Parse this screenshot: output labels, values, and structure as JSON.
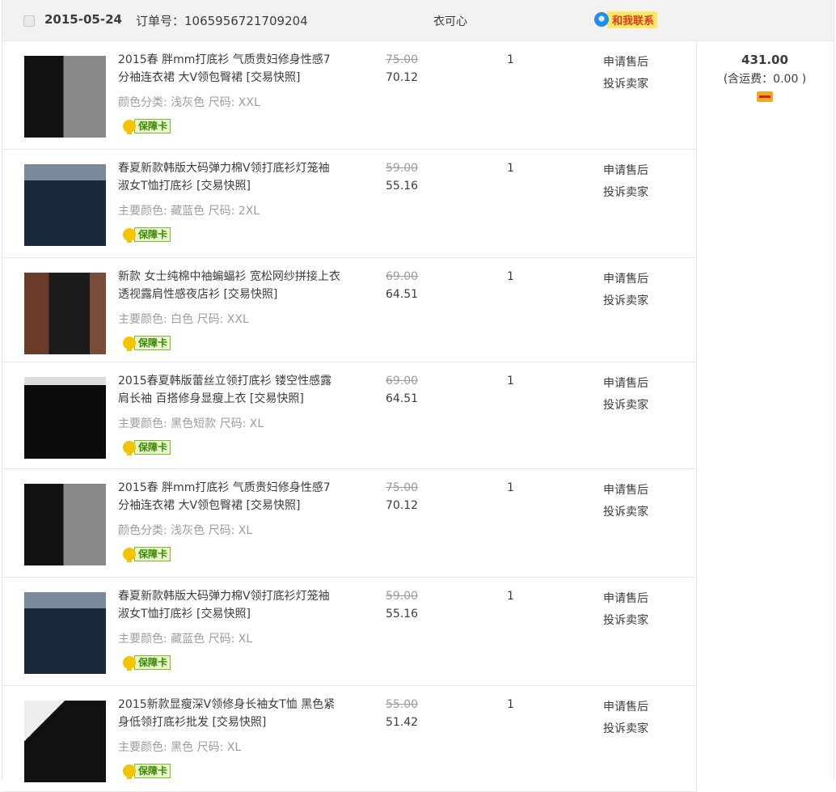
{
  "order": {
    "date": "2015-05-24",
    "order_label": "订单号：1065956721709204",
    "shop": "衣可心",
    "chat_label": "和我联系",
    "total": "431.00",
    "shipping": "(含运费：0.00 )"
  },
  "items": [
    {
      "title": "2015春 胖mm打底衫 气质贵妇修身性感7分袖连衣裙 大V领包臀裙 [交易快照]",
      "sku": "颜色分类: 浅灰色 尺码: XXL",
      "orig": "75.00",
      "price": "70.12",
      "qty": "1",
      "op1": "申请售后",
      "op2": "投诉卖家",
      "badge": "保障卡"
    },
    {
      "title": "春夏新款韩版大码弹力棉V领打底衫灯笼袖淑女T恤打底衫 [交易快照]",
      "sku": "主要颜色: 藏蓝色 尺码: 2XL",
      "orig": "59.00",
      "price": "55.16",
      "qty": "1",
      "op1": "申请售后",
      "op2": "投诉卖家",
      "badge": "保障卡"
    },
    {
      "title": "新款 女士纯棉中袖蝙蝠衫 宽松网纱拼接上衣 透视露肩性感夜店衫 [交易快照]",
      "sku": "主要颜色: 白色 尺码: XXL",
      "orig": "69.00",
      "price": "64.51",
      "qty": "1",
      "op1": "申请售后",
      "op2": "投诉卖家",
      "badge": "保障卡"
    },
    {
      "title": "2015春夏韩版蕾丝立领打底衫 镂空性感露肩长袖 百搭修身显瘦上衣 [交易快照]",
      "sku": "主要颜色: 黑色短款 尺码: XL",
      "orig": "69.00",
      "price": "64.51",
      "qty": "1",
      "op1": "申请售后",
      "op2": "投诉卖家",
      "badge": "保障卡"
    },
    {
      "title": "2015春 胖mm打底衫 气质贵妇修身性感7分袖连衣裙 大V领包臀裙 [交易快照]",
      "sku": "颜色分类: 浅灰色 尺码: XL",
      "orig": "75.00",
      "price": "70.12",
      "qty": "1",
      "op1": "申请售后",
      "op2": "投诉卖家",
      "badge": "保障卡"
    },
    {
      "title": "春夏新款韩版大码弹力棉V领打底衫灯笼袖淑女T恤打底衫 [交易快照]",
      "sku": "主要颜色: 藏蓝色 尺码: XL",
      "orig": "59.00",
      "price": "55.16",
      "qty": "1",
      "op1": "申请售后",
      "op2": "投诉卖家",
      "badge": "保障卡"
    },
    {
      "title": "2015新款显瘦深V领修身长袖女T恤 黑色紧身低领打底衫批发 [交易快照]",
      "sku": "主要颜色: 黑色 尺码: XL",
      "orig": "55.00",
      "price": "51.42",
      "qty": "1",
      "op1": "申请售后",
      "op2": "投诉卖家",
      "badge": "保障卡"
    }
  ]
}
